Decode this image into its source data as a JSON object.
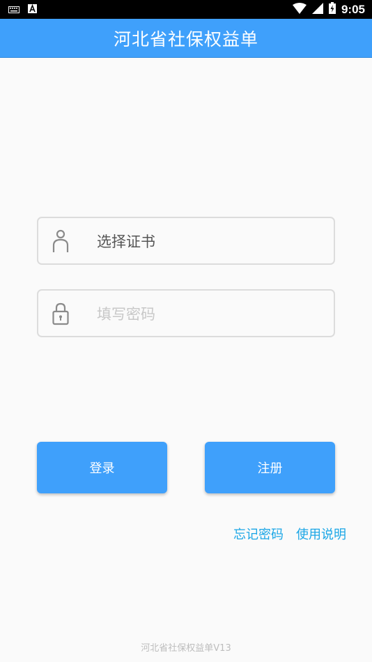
{
  "status_bar": {
    "time": "9:05",
    "icons": [
      "keyboard-icon",
      "a-badge-icon",
      "wifi-icon",
      "cell-signal-icon",
      "battery-charging-icon"
    ]
  },
  "app_bar": {
    "title": "河北省社保权益单"
  },
  "form": {
    "certificate_field": {
      "value": "选择证书",
      "icon": "person-icon"
    },
    "password_field": {
      "placeholder": "填写密码",
      "icon": "lock-icon"
    }
  },
  "buttons": {
    "login": "登录",
    "register": "注册"
  },
  "links": {
    "forgot_password": "忘记密码",
    "instructions": "使用说明"
  },
  "footer": {
    "version": "河北省社保权益单V13"
  },
  "colors": {
    "primary": "#3fa0fb",
    "link": "#1aa6e6",
    "border": "#dcdcdc"
  }
}
